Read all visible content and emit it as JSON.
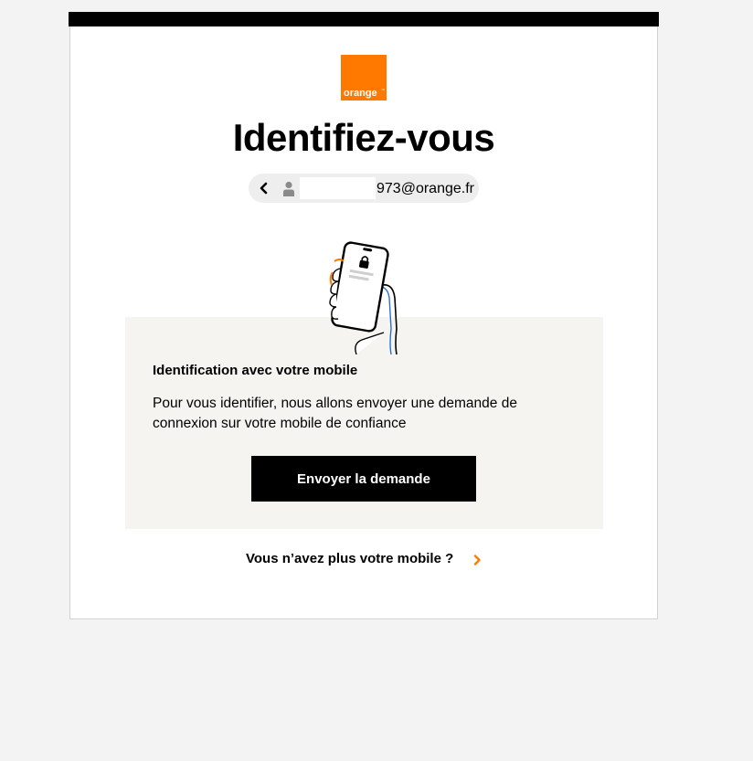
{
  "brand": {
    "name": "orange",
    "tm": "™",
    "color": "#ff7900"
  },
  "page": {
    "title": "Identifiez-vous"
  },
  "account": {
    "email_visible_part": "973@orange.fr",
    "icons": [
      "chevron-left-icon",
      "user-icon"
    ]
  },
  "mobile_auth": {
    "heading": "Identification avec votre mobile",
    "description": "Pour vous identifier, nous allons envoyer une demande de connexion sur votre mobile de confiance",
    "send_button_label": "Envoyer la demande"
  },
  "footer_link": {
    "label": "Vous n’avez plus votre mobile ?",
    "icon": "chevron-right-icon"
  },
  "colors": {
    "accent": "#ff7900",
    "panel_background": "#f6f4f0",
    "button_background": "#000000"
  }
}
